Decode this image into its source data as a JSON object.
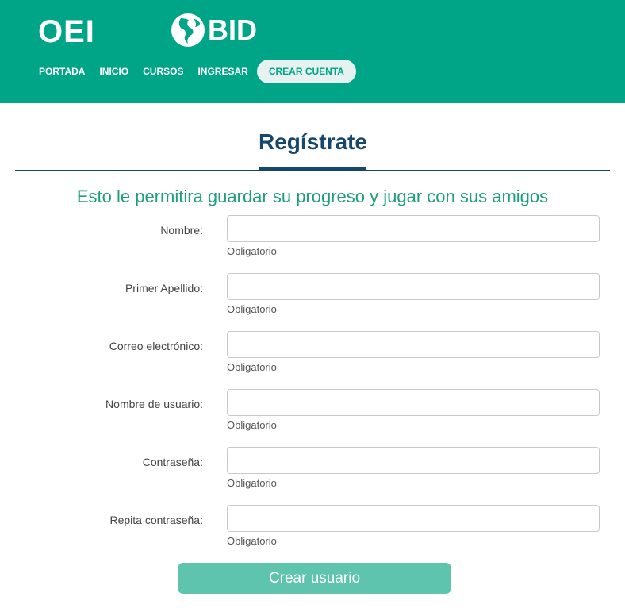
{
  "header": {
    "logo_oei": "OEI",
    "logo_bid": "BID",
    "nav": [
      {
        "label": "PORTADA"
      },
      {
        "label": "INICIO"
      },
      {
        "label": "CURSOS"
      },
      {
        "label": "INGRESAR"
      },
      {
        "label": "CREAR CUENTA",
        "active": true
      }
    ]
  },
  "main": {
    "title": "Regístrate",
    "subtitle": "Esto le permitira guardar su progreso y jugar con sus amigos"
  },
  "form": {
    "fields": [
      {
        "label": "Nombre:",
        "value": "",
        "help": "Obligatorio"
      },
      {
        "label": "Primer Apellido:",
        "value": "",
        "help": "Obligatorio"
      },
      {
        "label": "Correo electrónico:",
        "value": "",
        "help": "Obligatorio"
      },
      {
        "label": "Nombre de usuario:",
        "value": "",
        "help": "Obligatorio"
      },
      {
        "label": "Contraseña:",
        "value": "",
        "help": "Obligatorio"
      },
      {
        "label": "Repita contraseña:",
        "value": "",
        "help": "Obligatorio"
      }
    ],
    "submit_label": "Crear usuario"
  },
  "colors": {
    "header_bg": "#00a486",
    "title": "#18476d",
    "subtitle": "#1f9e7f",
    "button": "#5ec4ad"
  }
}
